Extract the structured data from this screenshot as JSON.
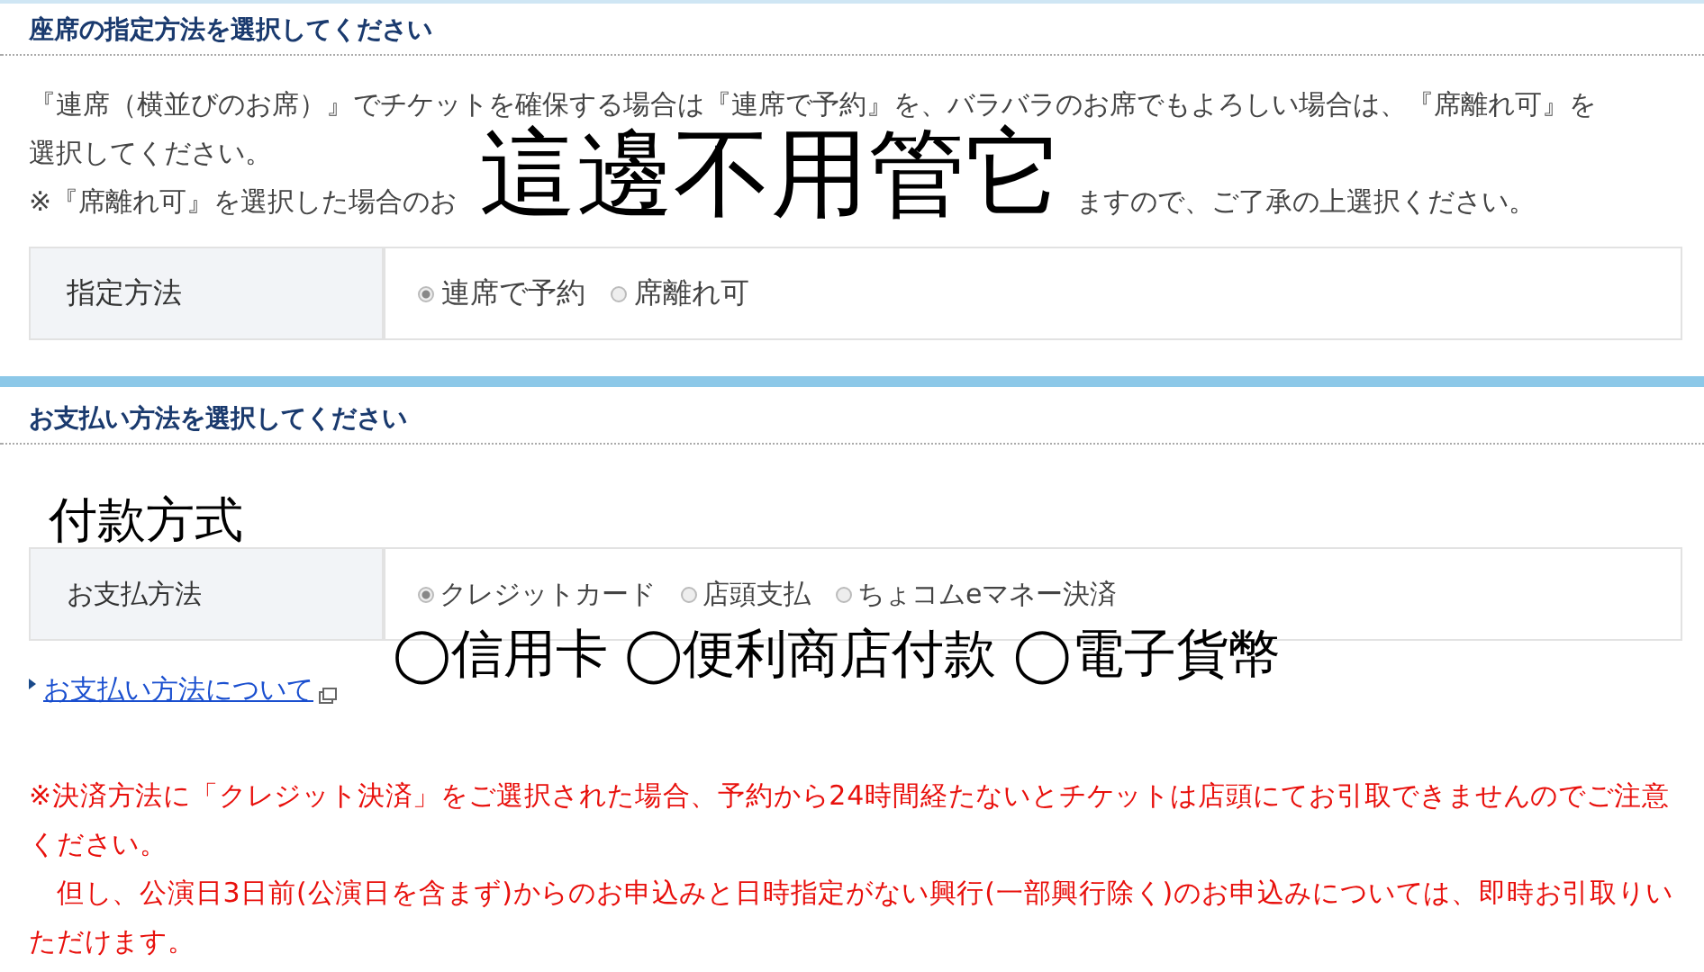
{
  "seat_section": {
    "heading": "座席の指定方法を選択してください",
    "lines": [
      {
        "parts": [
          "『連席（横並びのお席）』でチケットを確保する場合は『連席で予約』を、バラバラのお席でもよろしい場合は、『席離れ可』を"
        ]
      },
      {
        "parts": [
          "選択してください。"
        ]
      },
      {
        "parts": [
          "※『席離れ可』を選択した場合のお",
          "ますので、ご了承の上選択ください。"
        ]
      }
    ],
    "field": {
      "label": "指定方法",
      "options": [
        {
          "label": "連席で予約",
          "selected": true
        },
        {
          "label": "席離れ可",
          "selected": false
        }
      ]
    }
  },
  "payment_section": {
    "heading": "お支払い方法を選択してください",
    "field": {
      "label": "お支払方法",
      "options": [
        {
          "label": "クレジットカード",
          "selected": true
        },
        {
          "label": "店頭支払",
          "selected": false
        },
        {
          "label": "ちょコムeマネー決済",
          "selected": false
        }
      ]
    },
    "link": "お支払い方法について",
    "notes": [
      "※決済方法に「クレジット決済」をご選択された場合、予約から24時間経たないとチケットは店頭にてお引取できませんのでご注意ください。",
      "　但し、公演日3日前(公演日を含まず)からのお申込みと日時指定がない興行(一部興行除く)のお申込みについては、即時お引取りいただけます。"
    ]
  },
  "annotations": [
    {
      "kind": "large",
      "text": "這邊不用管它"
    },
    {
      "kind": "medium",
      "text": "付款方式"
    },
    {
      "kind": "options",
      "text": "◯信用卡 ◯便利商店付款 ◯電子貨幣"
    }
  ]
}
